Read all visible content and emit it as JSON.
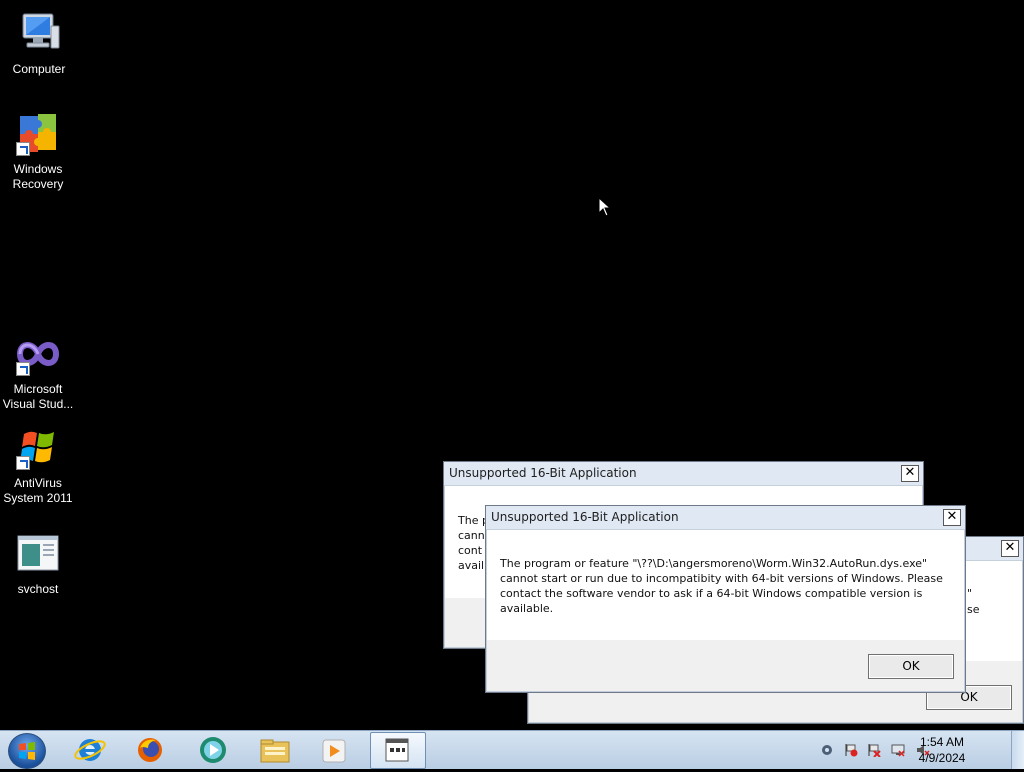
{
  "desktop": {
    "icons": [
      {
        "label": "Computer",
        "icon": "computer-icon"
      },
      {
        "label": "Windows\nRecovery",
        "icon": "puzzle-icon"
      },
      {
        "label": "Microsoft\nVisual Stud...",
        "icon": "visual-studio-icon"
      },
      {
        "label": "AntiVirus\nSystem 2011",
        "icon": "windows-flag-icon"
      },
      {
        "label": "svchost",
        "icon": "window-app-icon"
      }
    ]
  },
  "dialogs": {
    "back": {
      "title": "Unsupported 16-Bit Application",
      "close": "✕",
      "msg_partial": "The p\ncann\ncont\navail"
    },
    "right": {
      "close": "✕",
      "frag1": "\"",
      "frag2": "se",
      "ok": "OK"
    },
    "front": {
      "title": "Unsupported 16-Bit Application",
      "close": "✕",
      "message": "The program or feature \"\\??\\D:\\angersmoreno\\Worm.Win32.AutoRun.dys.exe\"\ncannot start or run due to incompatibity with 64-bit versions of Windows. Please\ncontact the software vendor to ask if a 64-bit Windows compatible version is\navailable.",
      "ok": "OK"
    }
  },
  "taskbar": {
    "start": "start-orb-icon",
    "pinned": [
      "internet-explorer-icon",
      "firefox-icon",
      "media-center-icon",
      "file-explorer-icon",
      "media-player-icon",
      "app-window-icon"
    ],
    "tray": [
      "network-icon",
      "action-center-icon",
      "flag-error-icon",
      "display-icon",
      "volume-muted-icon"
    ],
    "clock": {
      "time": "1:54 AM",
      "date": "4/9/2024"
    }
  }
}
